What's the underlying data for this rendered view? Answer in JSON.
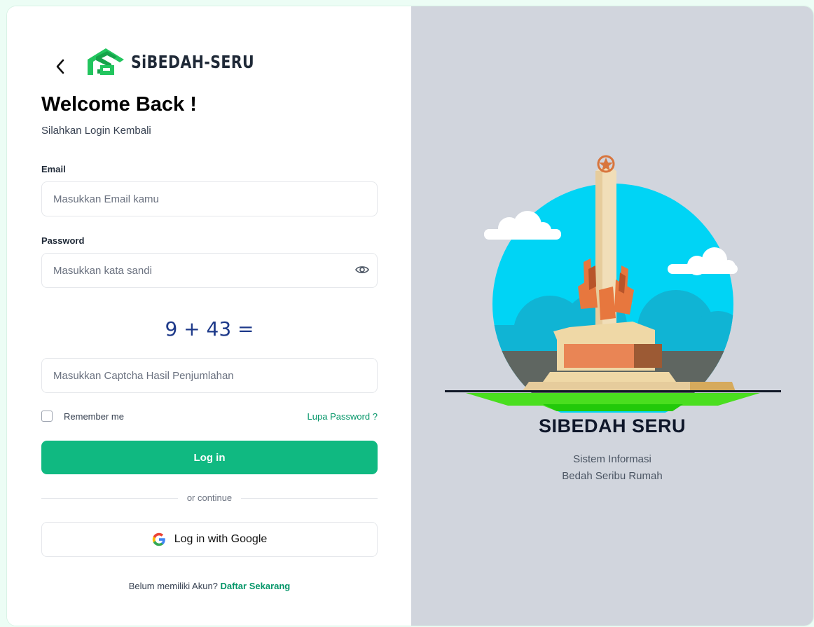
{
  "header": {
    "back_icon": "chevron-left-icon",
    "logo_text": "SiBEDAH-SERU",
    "brand_color": "#22c55e"
  },
  "form": {
    "title": "Welcome Back !",
    "subtitle": "Silahkan Login Kembali",
    "email_label": "Email",
    "email_placeholder": "Masukkan Email kamu",
    "password_label": "Password",
    "password_placeholder": "Masukkan kata sandi",
    "captcha_question": "9 + 43 =",
    "captcha_placeholder": "Masukkan Captcha Hasil Penjumlahan",
    "remember_label": "Remember me",
    "forgot_label": "Lupa Password ?",
    "login_label": "Log in",
    "divider_label": "or continue",
    "google_label": "Log in with Google",
    "signup_prompt": "Belum memiliki Akun?",
    "signup_link": "Daftar Sekarang",
    "accent": "#10b981"
  },
  "hero": {
    "name": "SIBEDAH SERU",
    "tagline_line1": "Sistem Informasi",
    "tagline_line2": "Bedah Seribu Rumah",
    "background": "#d1d5dd"
  }
}
